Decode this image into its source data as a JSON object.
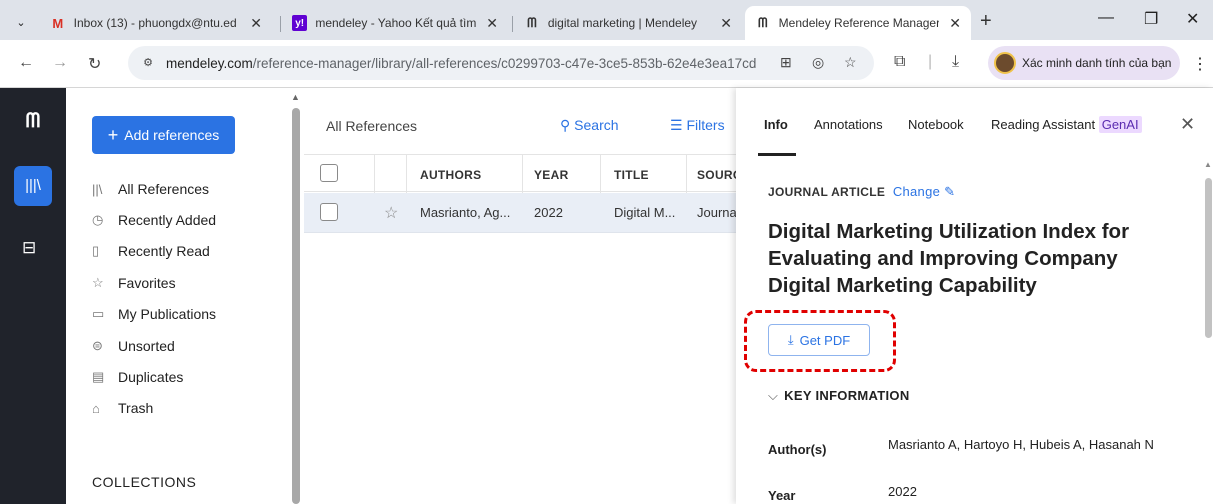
{
  "browser": {
    "tabs": [
      {
        "icon": "gmail-icon",
        "title": "Inbox (13) - phuongdx@ntu.ed",
        "active": false
      },
      {
        "icon": "yahoo-icon",
        "title": "mendeley - Yahoo Kết quả tìm k",
        "active": false
      },
      {
        "icon": "mendeley-icon",
        "title": "digital marketing | Mendeley",
        "active": false
      },
      {
        "icon": "mendeley-icon",
        "title": "Mendeley Reference Manager",
        "active": true
      }
    ],
    "url_domain": "mendeley.com",
    "url_path": "/reference-manager/library/all-references/c0299703-c47e-3ce5-853b-62e4e3ea17cd",
    "profile_label": "Xác minh danh tính của bạn"
  },
  "sidebar": {
    "add_button": "Add references",
    "items": [
      {
        "icon": "library-icon",
        "label": "All References"
      },
      {
        "icon": "clock-icon",
        "label": "Recently Added"
      },
      {
        "icon": "bookmark-icon",
        "label": "Recently Read"
      },
      {
        "icon": "star-icon",
        "label": "Favorites"
      },
      {
        "icon": "publication-icon",
        "label": "My Publications"
      },
      {
        "icon": "inbox-icon",
        "label": "Unsorted"
      },
      {
        "icon": "duplicate-icon",
        "label": "Duplicates"
      },
      {
        "icon": "trash-icon",
        "label": "Trash"
      }
    ],
    "collections_heading": "COLLECTIONS"
  },
  "list": {
    "title": "All References",
    "search_label": "Search",
    "filters_label": "Filters",
    "columns": [
      "AUTHORS",
      "YEAR",
      "TITLE",
      "SOURCE"
    ],
    "rows": [
      {
        "authors": "Masrianto, Ag...",
        "year": "2022",
        "title": "Digital M...",
        "source": "Journa"
      }
    ]
  },
  "details": {
    "tabs": [
      "Info",
      "Annotations",
      "Notebook",
      "Reading Assistant"
    ],
    "genai_badge": "GenAI",
    "type": "JOURNAL ARTICLE",
    "change_label": "Change",
    "title": "Digital Marketing Utilization Index for Evaluating and Improving Company Digital Marketing Capability",
    "get_pdf_label": "Get PDF",
    "key_info_heading": "KEY INFORMATION",
    "fields": [
      {
        "label": "Author(s)",
        "value": "Masrianto A, Hartoyo H, Hubeis A, Hasanah N"
      },
      {
        "label": "Year",
        "value": "2022"
      }
    ]
  },
  "colors": {
    "accent": "#2b73e3",
    "nav_dark": "#20232b",
    "highlight": "#e00000"
  }
}
